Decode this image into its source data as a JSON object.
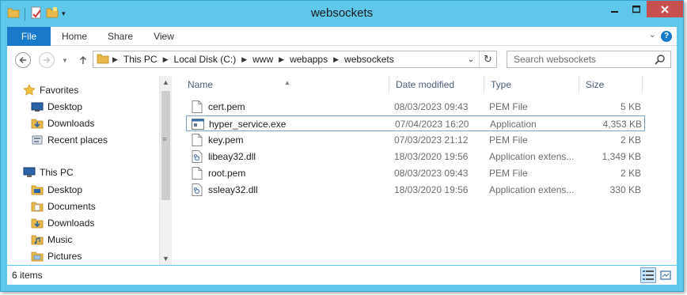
{
  "window": {
    "title": "websockets",
    "controls": [
      "minimize",
      "maximize",
      "close"
    ]
  },
  "quick_access": {
    "icons": [
      "folder-icon",
      "properties-icon",
      "new-folder-icon",
      "customize-dropdown-icon"
    ]
  },
  "ribbon": {
    "tabs": [
      {
        "label": "File",
        "active": true
      },
      {
        "label": "Home"
      },
      {
        "label": "Share"
      },
      {
        "label": "View"
      }
    ],
    "help_label": "?"
  },
  "address_bar": {
    "crumbs": [
      "This PC",
      "Local Disk (C:)",
      "www",
      "webapps",
      "websockets"
    ]
  },
  "search": {
    "placeholder": "Search websockets"
  },
  "nav_pane": {
    "favorites": {
      "label": "Favorites",
      "items": [
        "Desktop",
        "Downloads",
        "Recent places"
      ]
    },
    "this_pc": {
      "label": "This PC",
      "items": [
        "Desktop",
        "Documents",
        "Downloads",
        "Music",
        "Pictures"
      ]
    }
  },
  "file_list": {
    "columns": [
      "Name",
      "Date modified",
      "Type",
      "Size"
    ],
    "rows": [
      {
        "name": "cert.pem",
        "date": "08/03/2023 09:43",
        "type": "PEM File",
        "size": "5 KB",
        "icon": "file-icon"
      },
      {
        "name": "hyper_service.exe",
        "date": "07/04/2023 16:20",
        "type": "Application",
        "size": "4,353 KB",
        "icon": "application-icon",
        "selected": true
      },
      {
        "name": "key.pem",
        "date": "07/03/2023 21:12",
        "type": "PEM File",
        "size": "2 KB",
        "icon": "file-icon"
      },
      {
        "name": "libeay32.dll",
        "date": "18/03/2020 19:56",
        "type": "Application extens...",
        "size": "1,349 KB",
        "icon": "dll-icon"
      },
      {
        "name": "root.pem",
        "date": "08/03/2023 09:43",
        "type": "PEM File",
        "size": "2 KB",
        "icon": "file-icon"
      },
      {
        "name": "ssleay32.dll",
        "date": "18/03/2020 19:56",
        "type": "Application extens...",
        "size": "330 KB",
        "icon": "dll-icon"
      }
    ]
  },
  "status_bar": {
    "item_count": "6 items"
  },
  "colors": {
    "window_frame": "#5fc7ea",
    "file_tab": "#1979ca",
    "close_button": "#c7504f",
    "column_header_text": "#4c607a",
    "selection_border": "#7da2ce"
  }
}
